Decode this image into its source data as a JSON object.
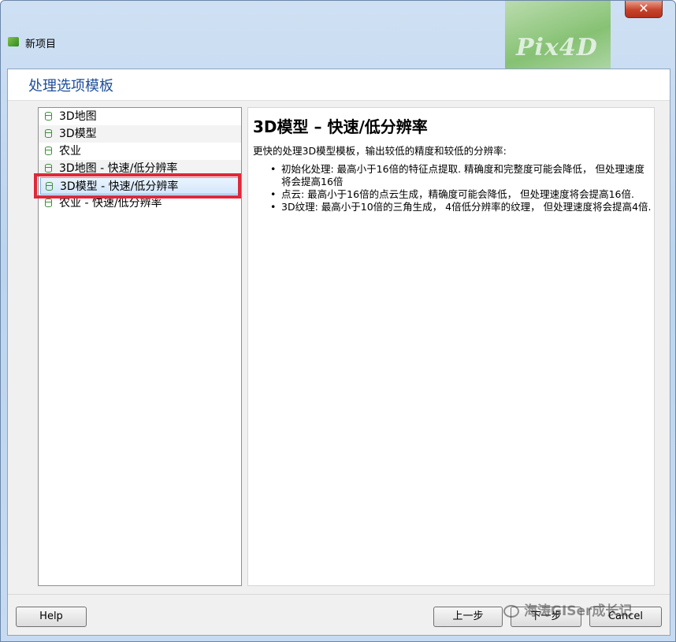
{
  "window": {
    "title": "新项目",
    "brand_text": "Pix4D"
  },
  "header": {
    "section_title": "处理选项模板"
  },
  "templates": {
    "items": [
      {
        "label": "3D地图"
      },
      {
        "label": "3D模型"
      },
      {
        "label": "农业"
      },
      {
        "label": "3D地图 - 快速/低分辨率"
      },
      {
        "label": "3D模型 - 快速/低分辨率"
      },
      {
        "label": "农业 - 快速/低分辨率"
      }
    ],
    "selected_index": 4
  },
  "description": {
    "title": "3D模型 – 快速/低分辨率",
    "intro": "更快的处理3D模型模板，输出较低的精度和较低的分辨率:",
    "bullets": [
      "初始化处理: 最高小于16倍的特征点提取. 精确度和完整度可能会降低， 但处理速度将会提高16倍",
      "点云: 最高小于16倍的点云生成，精确度可能会降低， 但处理速度将会提高16倍.",
      "3D纹理: 最高小于10倍的三角生成， 4倍低分辨率的纹理， 但处理速度将会提高4倍."
    ]
  },
  "buttons": {
    "help": "Help",
    "prev": "上一步",
    "next": "下一步",
    "cancel": "Cancel"
  },
  "watermark": "海涛GISer成长记",
  "colors": {
    "accent": "#1e4e9a",
    "highlight": "#e0283a",
    "icon": "#3f8f3a"
  }
}
